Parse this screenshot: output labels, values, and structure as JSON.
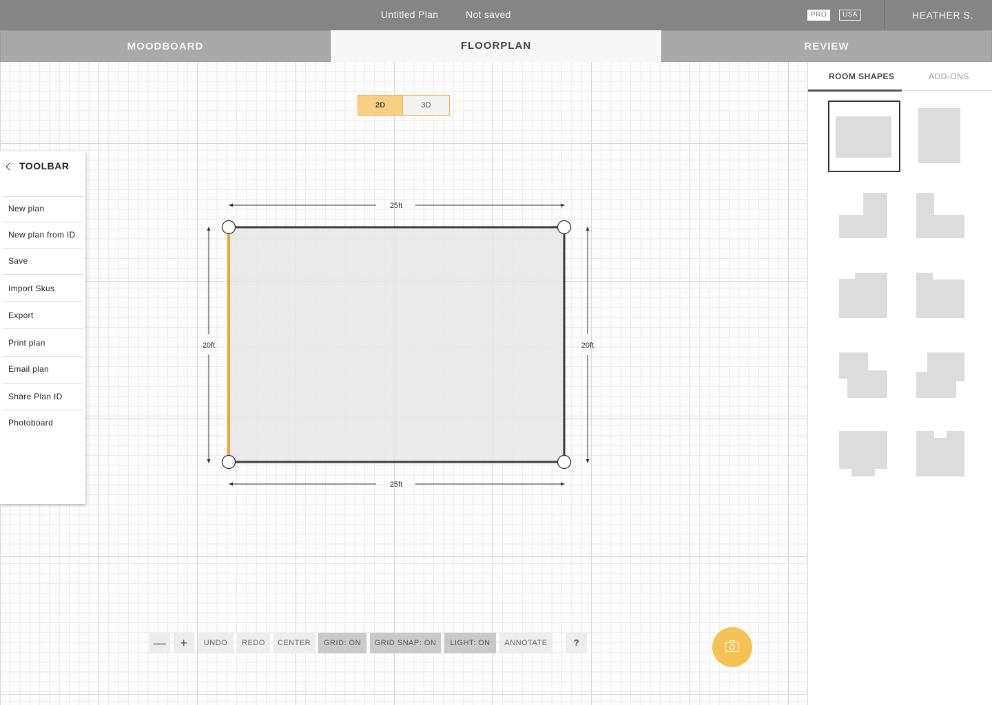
{
  "topbar": {
    "plan_title": "Untitled Plan",
    "save_status": "Not saved",
    "badge_pro": "PRO",
    "badge_usa": "USA",
    "user_name": "HEATHER S."
  },
  "tabs": {
    "moodboard": "MOODBOARD",
    "floorplan": "FLOORPLAN",
    "review": "REVIEW",
    "active": "FLOORPLAN"
  },
  "view_toggle": {
    "option_2d": "2D",
    "option_3d": "3D",
    "active": "2D"
  },
  "toolbar": {
    "title": "TOOLBAR",
    "items": [
      "New plan",
      "New plan from ID",
      "Save",
      "Import Skus",
      "Export",
      "Print plan",
      "Email plan",
      "Share Plan ID",
      "Photoboard"
    ]
  },
  "room": {
    "width_label_top": "25ft",
    "width_label_bottom": "25ft",
    "height_label_left": "20ft",
    "height_label_right": "20ft",
    "selected_wall": "left"
  },
  "controls": {
    "zoom_out": "—",
    "zoom_in": "+",
    "undo": "UNDO",
    "redo": "REDO",
    "center": "CENTER",
    "grid": "GRID: ON",
    "grid_snap": "GRID SNAP: ON",
    "light": "LIGHT: ON",
    "annotate": "ANNOTATE",
    "help": "?"
  },
  "right_panel": {
    "tab_room_shapes": "ROOM SHAPES",
    "tab_addons": "ADD-ONS",
    "active_tab": "ROOM SHAPES"
  },
  "colors": {
    "accent": "#f0a530",
    "accent_light": "#f7cf83",
    "topbar": "#858585",
    "room_fill": "#e6e6e6",
    "shape_fill": "#dcdcdc"
  }
}
